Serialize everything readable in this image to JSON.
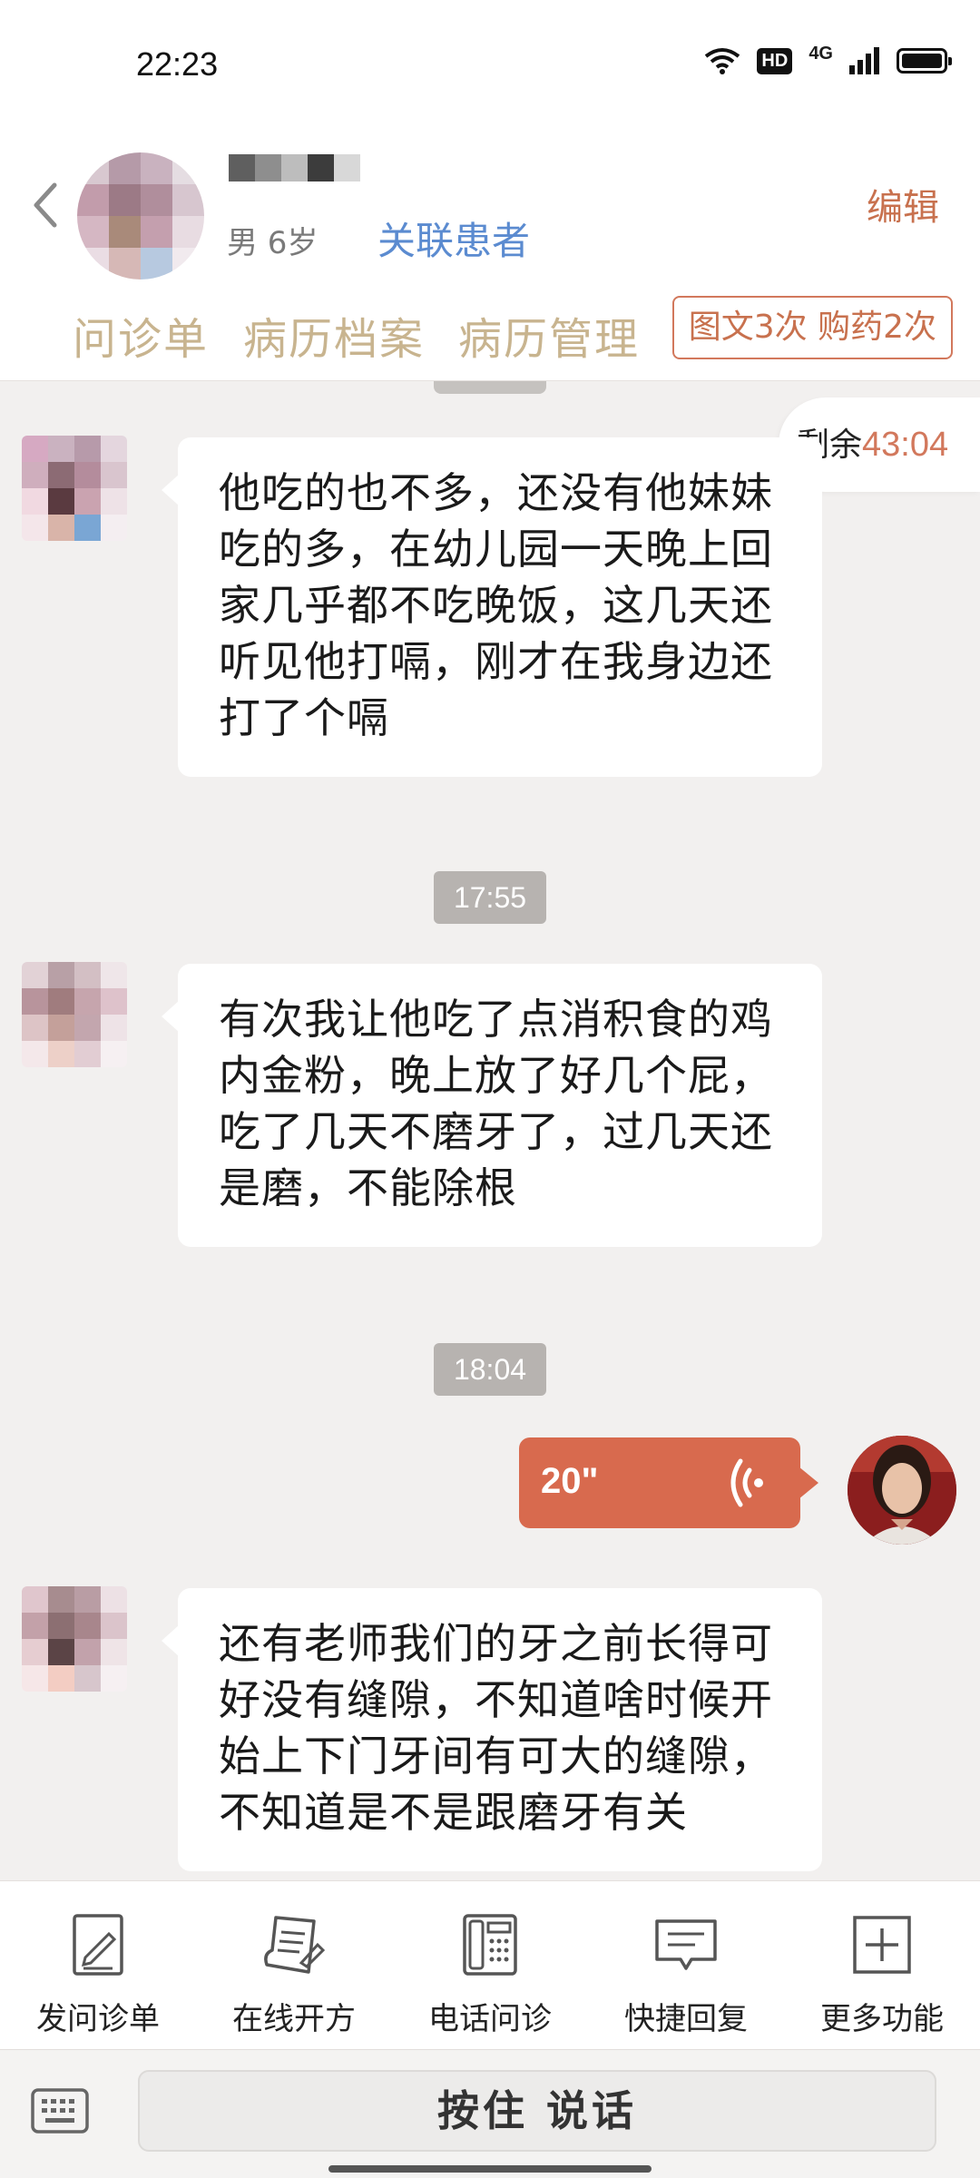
{
  "status_bar": {
    "time": "22:23",
    "hd": "HD",
    "network": "4G"
  },
  "header": {
    "gender_age": "男 6岁",
    "link_patient": "关联患者",
    "edit": "编辑"
  },
  "tabs": [
    {
      "label": "问诊单"
    },
    {
      "label": "病历档案"
    },
    {
      "label": "病历管理"
    }
  ],
  "count_badge": "图文3次 购药2次",
  "remaining": {
    "label": "剩余",
    "time": "43:04"
  },
  "messages": [
    {
      "text": "他吃的也不多，还没有他妹妹吃的多，在幼儿园一天晚上回家几乎都不吃晚饭，这几天还听见他打嗝，刚才在我身边还打了个嗝"
    },
    {
      "time": "17:55",
      "text": "有次我让他吃了点消积食的鸡内金粉，晚上放了好几个屁，吃了几天不磨牙了，过几天还是磨，不能除根"
    },
    {
      "time": "18:04",
      "voice_duration": "20\""
    },
    {
      "text": "还有老师我们的牙之前长得可好没有缝隙，不知道啥时候开始上下门牙间有可大的缝隙，不知道是不是跟磨牙有关"
    }
  ],
  "toolbar": [
    {
      "label": "发问诊单",
      "icon": "questionnaire-icon"
    },
    {
      "label": "在线开方",
      "icon": "prescription-icon"
    },
    {
      "label": "电话问诊",
      "icon": "phone-icon"
    },
    {
      "label": "快捷回复",
      "icon": "quick-reply-icon"
    },
    {
      "label": "更多功能",
      "icon": "more-icon"
    }
  ],
  "input": {
    "hold_to_talk": "按住 说话"
  },
  "colors": {
    "accent": "#d86a4e",
    "tab_text": "#c8b48f",
    "link": "#5b8bd0",
    "background": "#f2f0ef"
  }
}
